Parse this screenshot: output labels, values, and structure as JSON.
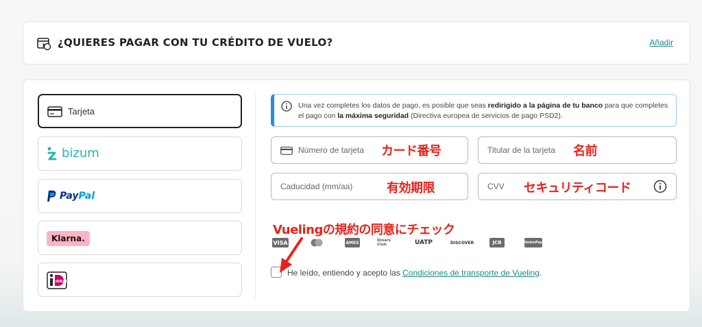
{
  "credit_bar": {
    "title": "¿QUIERES PAGAR CON TU CRÉDITO DE VUELO?",
    "add_link": "Añadir"
  },
  "payment_methods": [
    {
      "label": "Tarjeta",
      "icon": "credit-card-icon",
      "selected": true
    },
    {
      "label": "bizum",
      "icon": "bizum-logo",
      "selected": false
    },
    {
      "label": "PayPal",
      "icon": "paypal-logo",
      "selected": false
    },
    {
      "label": "Klarna.",
      "icon": "klarna-logo",
      "selected": false
    },
    {
      "label": "iDEAL",
      "icon": "ideal-logo",
      "selected": false
    }
  ],
  "notice": {
    "part1": "Una vez completes los datos de pago, es posible que seas ",
    "bold1": "redirigido a la página de tu banco",
    "part2": " para que completes el pago con ",
    "bold2": "la máxima seguridad",
    "part3": " (Directiva europea de servicios de pago PSD2)."
  },
  "fields": {
    "card_number": "Número de tarjeta",
    "card_holder": "Titular de la tarjeta",
    "expiry": "Caducidad (mm/aa)",
    "cvv": "CVV"
  },
  "annotations": {
    "card_number": "カード番号",
    "name": "名前",
    "expiry": "有効期限",
    "security_code": "セキュリティコード",
    "terms": "Vuelingの規約の同意にチェック"
  },
  "card_brands": [
    "VISA",
    "mastercard",
    "AMEX",
    "Diners Club",
    "UATP",
    "DISCOVER",
    "JCB",
    "UnionPay"
  ],
  "terms": {
    "text": "He leído, entiendo y acepto las ",
    "link": "Condiciones de transporte de Vueling",
    "end": "."
  },
  "colors": {
    "accent": "#1b8a8a",
    "notice_border": "#2a8be0",
    "annotation_red": "#e8221b"
  }
}
